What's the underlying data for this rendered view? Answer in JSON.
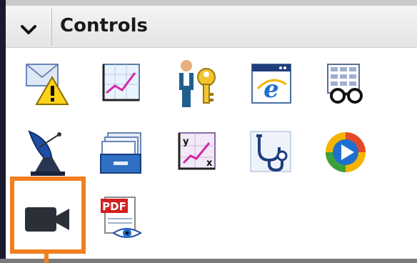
{
  "panel": {
    "title": "Controls",
    "collapse_icon": "chevron-down-icon"
  },
  "icons": [
    {
      "name": "mail-warning-icon",
      "label": ""
    },
    {
      "name": "line-chart-icon",
      "label": ""
    },
    {
      "name": "user-key-icon",
      "label": ""
    },
    {
      "name": "browser-e-icon",
      "label": ""
    },
    {
      "name": "data-glasses-icon",
      "label": ""
    },
    {
      "name": "satellite-dish-icon",
      "label": ""
    },
    {
      "name": "card-file-icon",
      "label": ""
    },
    {
      "name": "xy-chart-icon",
      "label": ""
    },
    {
      "name": "stethoscope-icon",
      "label": ""
    },
    {
      "name": "media-play-icon",
      "label": ""
    },
    {
      "name": "video-camera-icon",
      "label": ""
    },
    {
      "name": "pdf-viewer-icon",
      "label": "PDF"
    }
  ],
  "colors": {
    "highlight": "#f07f1e",
    "header_bg": "#ececec",
    "accent_blue": "#1f5fbf"
  }
}
